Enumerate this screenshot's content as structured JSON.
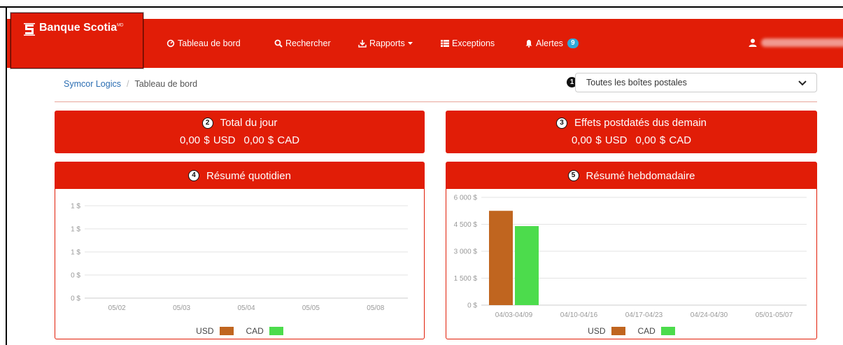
{
  "brand": {
    "name": "Banque Scotia",
    "mark": "MD"
  },
  "nav": {
    "items": [
      {
        "label": "Tableau de bord",
        "icon": "dashboard-icon"
      },
      {
        "label": "Rechercher",
        "icon": "search-icon"
      },
      {
        "label": "Rapports",
        "icon": "download-icon"
      },
      {
        "label": "Exceptions",
        "icon": "list-icon"
      },
      {
        "label": "Alertes",
        "icon": "bell-icon",
        "badge": "9"
      }
    ]
  },
  "breadcrumb": {
    "root": "Symcor Logics",
    "separator": "/",
    "current": "Tableau de bord"
  },
  "filter": {
    "step": "1",
    "selected": "Toutes les boîtes postales"
  },
  "summary": {
    "today": {
      "step": "2",
      "title": "Total du jour",
      "usd": "0,00 $ USD",
      "cad": "0,00 $ CAD"
    },
    "postdated": {
      "step": "3",
      "title": "Effets postdatés dus demain",
      "usd": "0,00 $ USD",
      "cad": "0,00 $ CAD"
    }
  },
  "daily": {
    "step": "4",
    "title": "Résumé quotidien"
  },
  "weekly": {
    "step": "5",
    "title": "Résumé hebdomadaire"
  },
  "legend": {
    "usd": "USD",
    "cad": "CAD"
  },
  "colors": {
    "brand_red": "#e11d07",
    "usd": "#c0651f",
    "cad": "#4cdc4c",
    "badge": "#2ea8d8"
  },
  "chart_data": [
    {
      "type": "bar",
      "title": "Résumé quotidien",
      "categories": [
        "05/02",
        "05/03",
        "05/04",
        "05/05",
        "05/08"
      ],
      "y_ticks": [
        "1 $",
        "1 $",
        "1 $",
        "0 $",
        "0 $"
      ],
      "series": [
        {
          "name": "USD",
          "values": [
            0,
            0,
            0,
            0,
            0
          ]
        },
        {
          "name": "CAD",
          "values": [
            0,
            0,
            0,
            0,
            0
          ]
        }
      ],
      "legend": "bottom"
    },
    {
      "type": "bar",
      "title": "Résumé hebdomadaire",
      "categories": [
        "04/03-04/09",
        "04/10-04/16",
        "04/17-04/23",
        "04/24-04/30",
        "05/01-05/07"
      ],
      "y_ticks": [
        "6 000 $",
        "4 500 $",
        "3 000 $",
        "1 500 $",
        "0 $"
      ],
      "ylim": [
        0,
        6000
      ],
      "series": [
        {
          "name": "USD",
          "values": [
            5250,
            0,
            0,
            0,
            0
          ]
        },
        {
          "name": "CAD",
          "values": [
            4400,
            0,
            0,
            0,
            0
          ]
        }
      ],
      "legend": "bottom"
    }
  ]
}
